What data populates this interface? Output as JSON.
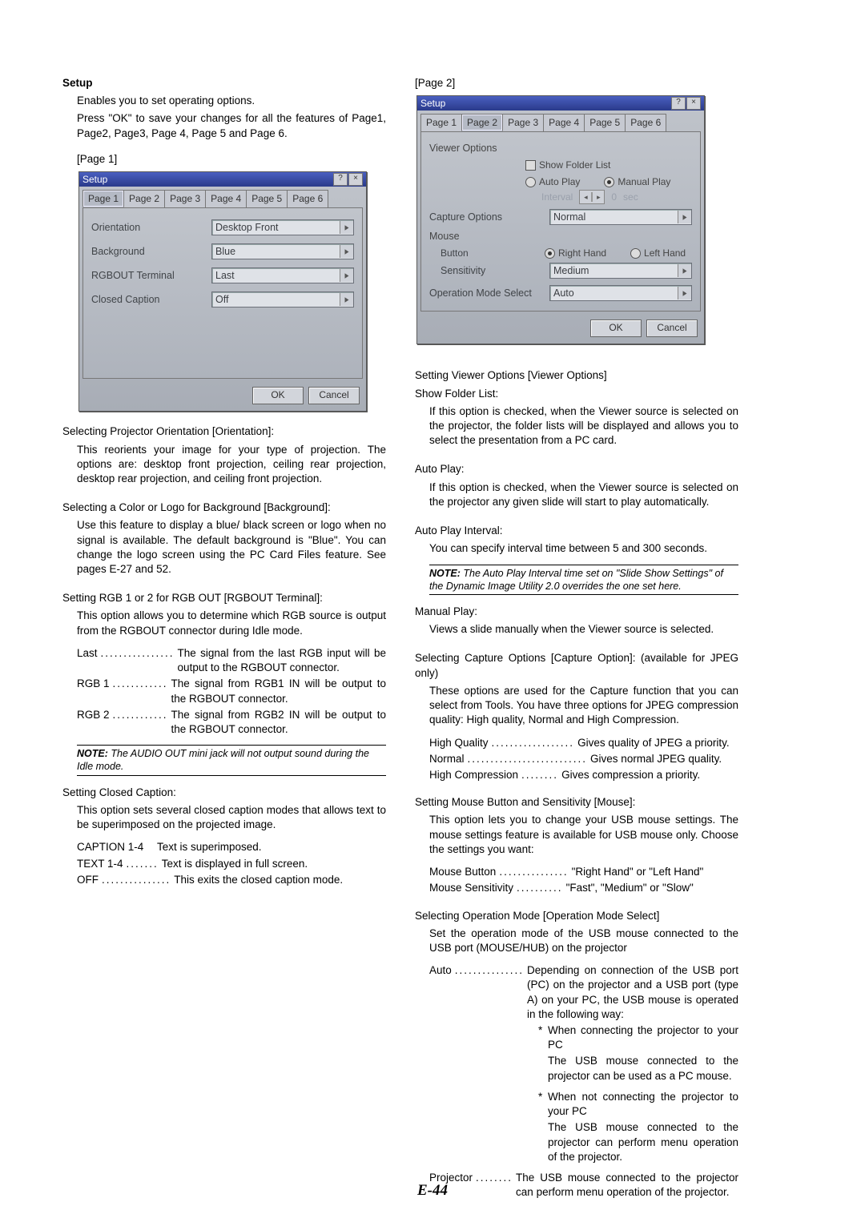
{
  "pageNumber": "E-44",
  "left": {
    "setupTitle": "Setup",
    "setupLine1": "Enables you to set operating options.",
    "setupLine2": "Press \"OK\" to save your changes for all the features of Page1, Page2, Page3, Page 4, Page 5 and Page 6.",
    "page1Label": "[Page 1]",
    "dialog1": {
      "title": "Setup",
      "tabs": [
        "Page 1",
        "Page 2",
        "Page 3",
        "Page 4",
        "Page 5",
        "Page 6"
      ],
      "activeTab": 0,
      "rows": [
        {
          "label": "Orientation",
          "value": "Desktop Front"
        },
        {
          "label": "Background",
          "value": "Blue"
        },
        {
          "label": "RGBOUT Terminal",
          "value": "Last"
        },
        {
          "label": "Closed Caption",
          "value": "Off"
        }
      ],
      "ok": "OK",
      "cancel": "Cancel"
    },
    "orientTitle": "Selecting Projector Orientation [Orientation]:",
    "orientBody": "This reorients your image for your type of projection. The options are: desktop front projection, ceiling rear projection, desktop rear projection, and ceiling front projection.",
    "bgTitle": "Selecting a Color or Logo for Background [Background]:",
    "bgBody": "Use this feature to display a blue/ black screen or logo when no signal is available. The default background is \"Blue\". You can change the logo screen using the PC Card Files feature. See pages E-27 and 52.",
    "rgbTitle": "Setting RGB 1 or 2 for RGB OUT [RGBOUT Terminal]:",
    "rgbBody": "This option allows you to determine which RGB source is output from the RGBOUT connector during Idle mode.",
    "rgbList": [
      {
        "t": "Last",
        "d": "The signal from the last RGB input will be output to the RGBOUT connector."
      },
      {
        "t": "RGB 1",
        "d": "The signal from RGB1 IN will be output to the RGBOUT connector."
      },
      {
        "t": "RGB 2",
        "d": "The signal from RGB2 IN will be output to the RGBOUT connector."
      }
    ],
    "note1Lbl": "NOTE:",
    "note1": "The AUDIO OUT mini jack will not output sound during the Idle mode.",
    "ccTitle": "Setting Closed Caption:",
    "ccBody": "This option sets several closed caption modes that allows text to be superimposed on the projected image.",
    "ccList": [
      {
        "t": "CAPTION 1-4",
        "d": "Text is superimposed."
      },
      {
        "t": "TEXT 1-4",
        "d": "Text is displayed in full screen."
      },
      {
        "t": "OFF",
        "d": "This exits the closed caption mode."
      }
    ]
  },
  "right": {
    "page2Label": "[Page 2]",
    "dialog2": {
      "title": "Setup",
      "tabs": [
        "Page 1",
        "Page 2",
        "Page 3",
        "Page 4",
        "Page 5",
        "Page 6"
      ],
      "activeTab": 1,
      "viewerOptions": "Viewer Options",
      "showFolder": "Show Folder List",
      "autoPlay": "Auto Play",
      "manualPlay": "Manual Play",
      "interval": "Interval",
      "intervalVal": "0",
      "intervalSec": "sec",
      "captureLabel": "Capture Options",
      "captureVal": "Normal",
      "mouse": "Mouse",
      "button": "Button",
      "rightHand": "Right Hand",
      "leftHand": "Left Hand",
      "sensitivity": "Sensitivity",
      "sensVal": "Medium",
      "opmode": "Operation Mode Select",
      "opmodeVal": "Auto",
      "ok": "OK",
      "cancel": "Cancel"
    },
    "voTitle": "Setting Viewer Options [Viewer Options]",
    "sflTitle": "Show Folder List:",
    "sflBody": "If this option is checked, when the Viewer source is selected on the projector, the folder lists will be displayed and allows you to select the presentation from a PC card.",
    "apTitle": "Auto Play:",
    "apBody": "If this option is checked, when the Viewer source is selected on the projector any given slide will start to play automatically.",
    "apiTitle": "Auto Play Interval:",
    "apiBody": "You can specify interval time between 5 and 300 seconds.",
    "note2Lbl": "NOTE:",
    "note2": "The Auto Play Interval time set on \"Slide Show Settings\" of the Dynamic Image Utility 2.0 overrides the one set here.",
    "mpTitle": "Manual Play:",
    "mpBody": "Views a slide manually when the Viewer source is selected.",
    "capTitle": "Selecting Capture Options [Capture Option]: (available for JPEG only)",
    "capBody": "These options are used for the Capture function that you can select from Tools. You have three options for JPEG compression quality: High quality, Normal and High Compression.",
    "capList": [
      {
        "t": "High Quality",
        "d": "Gives quality of JPEG a priority."
      },
      {
        "t": "Normal",
        "d": "Gives normal JPEG quality."
      },
      {
        "t": "High Compression",
        "d": "Gives compression a priority."
      }
    ],
    "msTitle": "Setting Mouse Button and Sensitivity [Mouse]:",
    "msBody": "This option lets you to change your USB mouse settings. The mouse settings feature is available for USB mouse only. Choose the settings you want:",
    "msList": [
      {
        "t": "Mouse Button",
        "d": "\"Right Hand\" or \"Left Hand\""
      },
      {
        "t": "Mouse Sensitivity",
        "d": "\"Fast\", \"Medium\" or \"Slow\""
      }
    ],
    "omTitle": "Selecting Operation Mode [Operation Mode Select]",
    "omBody": "Set the operation mode of the USB mouse connected to the USB port (MOUSE/HUB) on the projector",
    "omAutoT": "Auto",
    "omAutoD": "Depending on connection of the USB port (PC) on the projector and a USB port (type A) on your PC, the USB mouse is operated in the following way:",
    "omB1t": "When connecting the projector to your PC",
    "omB1d": "The USB mouse connected to the projector can be used as a PC mouse.",
    "omB2t": "When not connecting the projector to your PC",
    "omB2d": "The USB mouse connected to the projector can perform menu operation of the projector.",
    "omProjT": "Projector",
    "omProjD": "The USB mouse connected to the projector can perform menu operation of the projector."
  }
}
